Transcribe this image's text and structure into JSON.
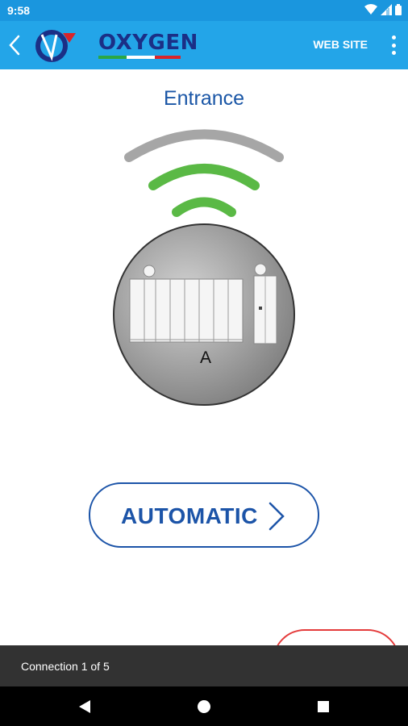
{
  "status_bar": {
    "time": "9:58",
    "icons": [
      "wifi-icon",
      "signal-icon",
      "battery-icon"
    ]
  },
  "app_bar": {
    "logo_text": "OXYGEN",
    "website_label": "WEB SITE",
    "background_color": "#23a5e8"
  },
  "main": {
    "title": "Entrance",
    "device_label": "A",
    "signal_colors": [
      "#a6a6a6",
      "#5ab945",
      "#5ab945"
    ],
    "mode_button_label": "AUTOMATIC"
  },
  "snackbar": {
    "message": "Connection 1 of 5"
  },
  "nav_bar": {
    "icons": [
      "back-triangle-icon",
      "home-circle-icon",
      "recents-square-icon"
    ]
  },
  "colors": {
    "accent_blue": "#1c54a8",
    "status_blue": "#1a96de"
  }
}
